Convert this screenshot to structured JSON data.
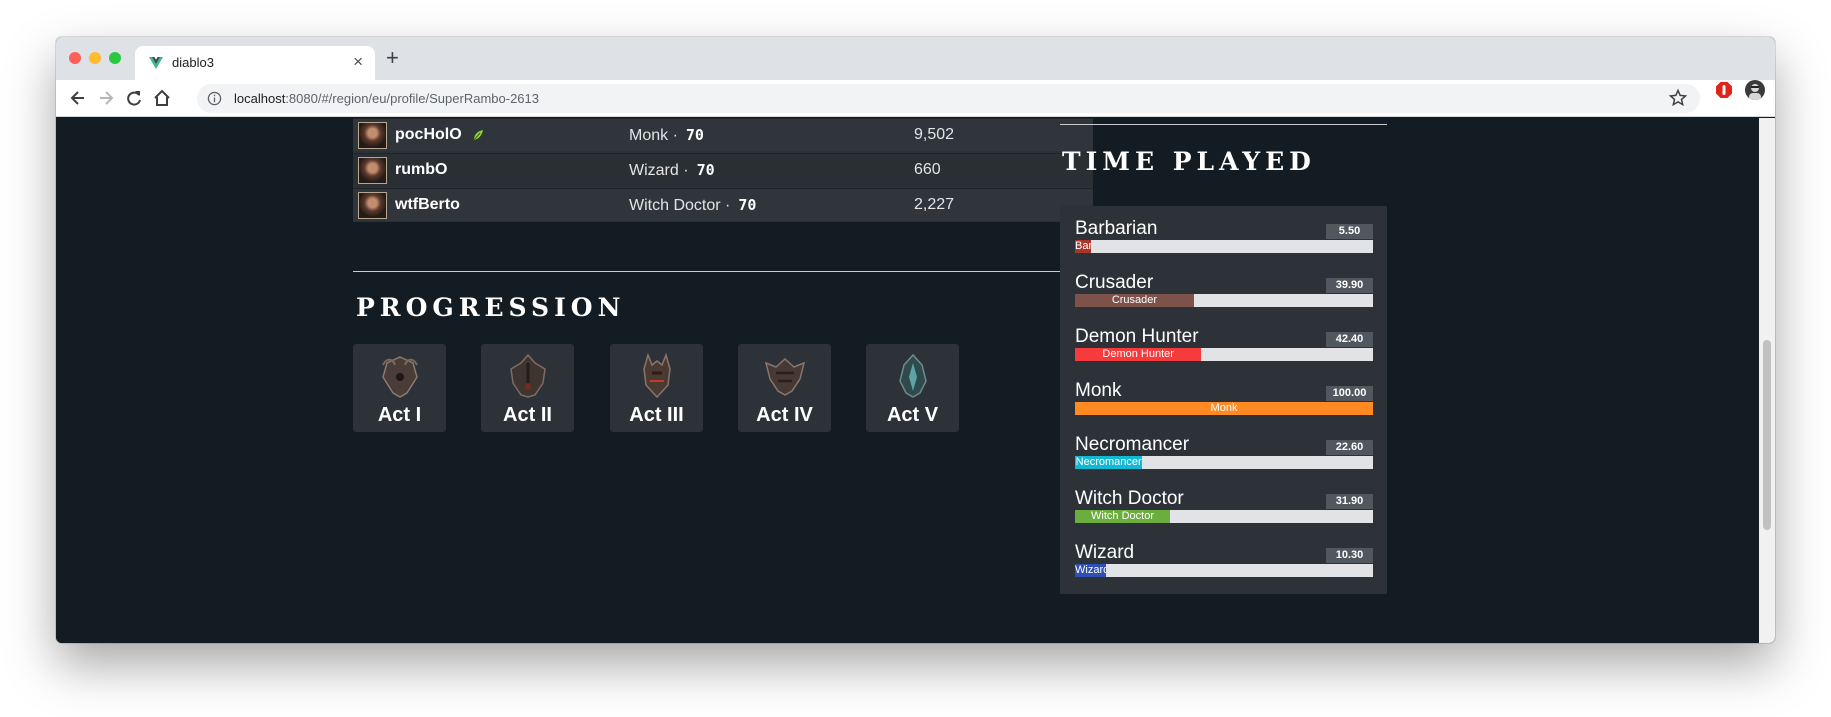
{
  "browser": {
    "tab_title": "diablo3",
    "url_host": "localhost",
    "url_rest": ":8080/#/region/eu/profile/SuperRambo-2613"
  },
  "heroes": [
    {
      "name": "pocHolO",
      "class": "Monk ·",
      "level": "70",
      "points": "9,502",
      "seasonal": true
    },
    {
      "name": "rumbO",
      "class": "Wizard ·",
      "level": "70",
      "points": "660",
      "seasonal": false
    },
    {
      "name": "wtfBerto",
      "class": "Witch Doctor ·",
      "level": "70",
      "points": "2,227",
      "seasonal": false
    }
  ],
  "progression": {
    "title": "PROGRESSION",
    "acts": [
      {
        "label": "Act I",
        "emblem_color": "#4a3c36"
      },
      {
        "label": "Act II",
        "emblem_color": "#3e3530"
      },
      {
        "label": "Act III",
        "emblem_color": "#4b3a32"
      },
      {
        "label": "Act IV",
        "emblem_color": "#463934"
      },
      {
        "label": "Act V",
        "emblem_color": "#2f4a4c"
      }
    ]
  },
  "time_played": {
    "title": "TIME PLAYED",
    "items": [
      {
        "name": "Barbarian",
        "value": "5.50",
        "percent": 5.5,
        "bar_label": "Barbarian",
        "color": "#a8352a"
      },
      {
        "name": "Crusader",
        "value": "39.90",
        "percent": 39.9,
        "bar_label": "Crusader",
        "color": "#7d524a"
      },
      {
        "name": "Demon Hunter",
        "value": "42.40",
        "percent": 42.4,
        "bar_label": "Demon Hunter",
        "color": "#f53b3b"
      },
      {
        "name": "Monk",
        "value": "100.00",
        "percent": 100,
        "bar_label": "Monk",
        "color": "#ff8a24"
      },
      {
        "name": "Necromancer",
        "value": "22.60",
        "percent": 22.6,
        "bar_label": "Necromancer",
        "color": "#12b9d4"
      },
      {
        "name": "Witch Doctor",
        "value": "31.90",
        "percent": 31.9,
        "bar_label": "Witch Doctor",
        "color": "#6bad3e"
      },
      {
        "name": "Wizard",
        "value": "10.30",
        "percent": 10.3,
        "bar_label": "Wizard",
        "color": "#2f4fb4"
      }
    ]
  }
}
